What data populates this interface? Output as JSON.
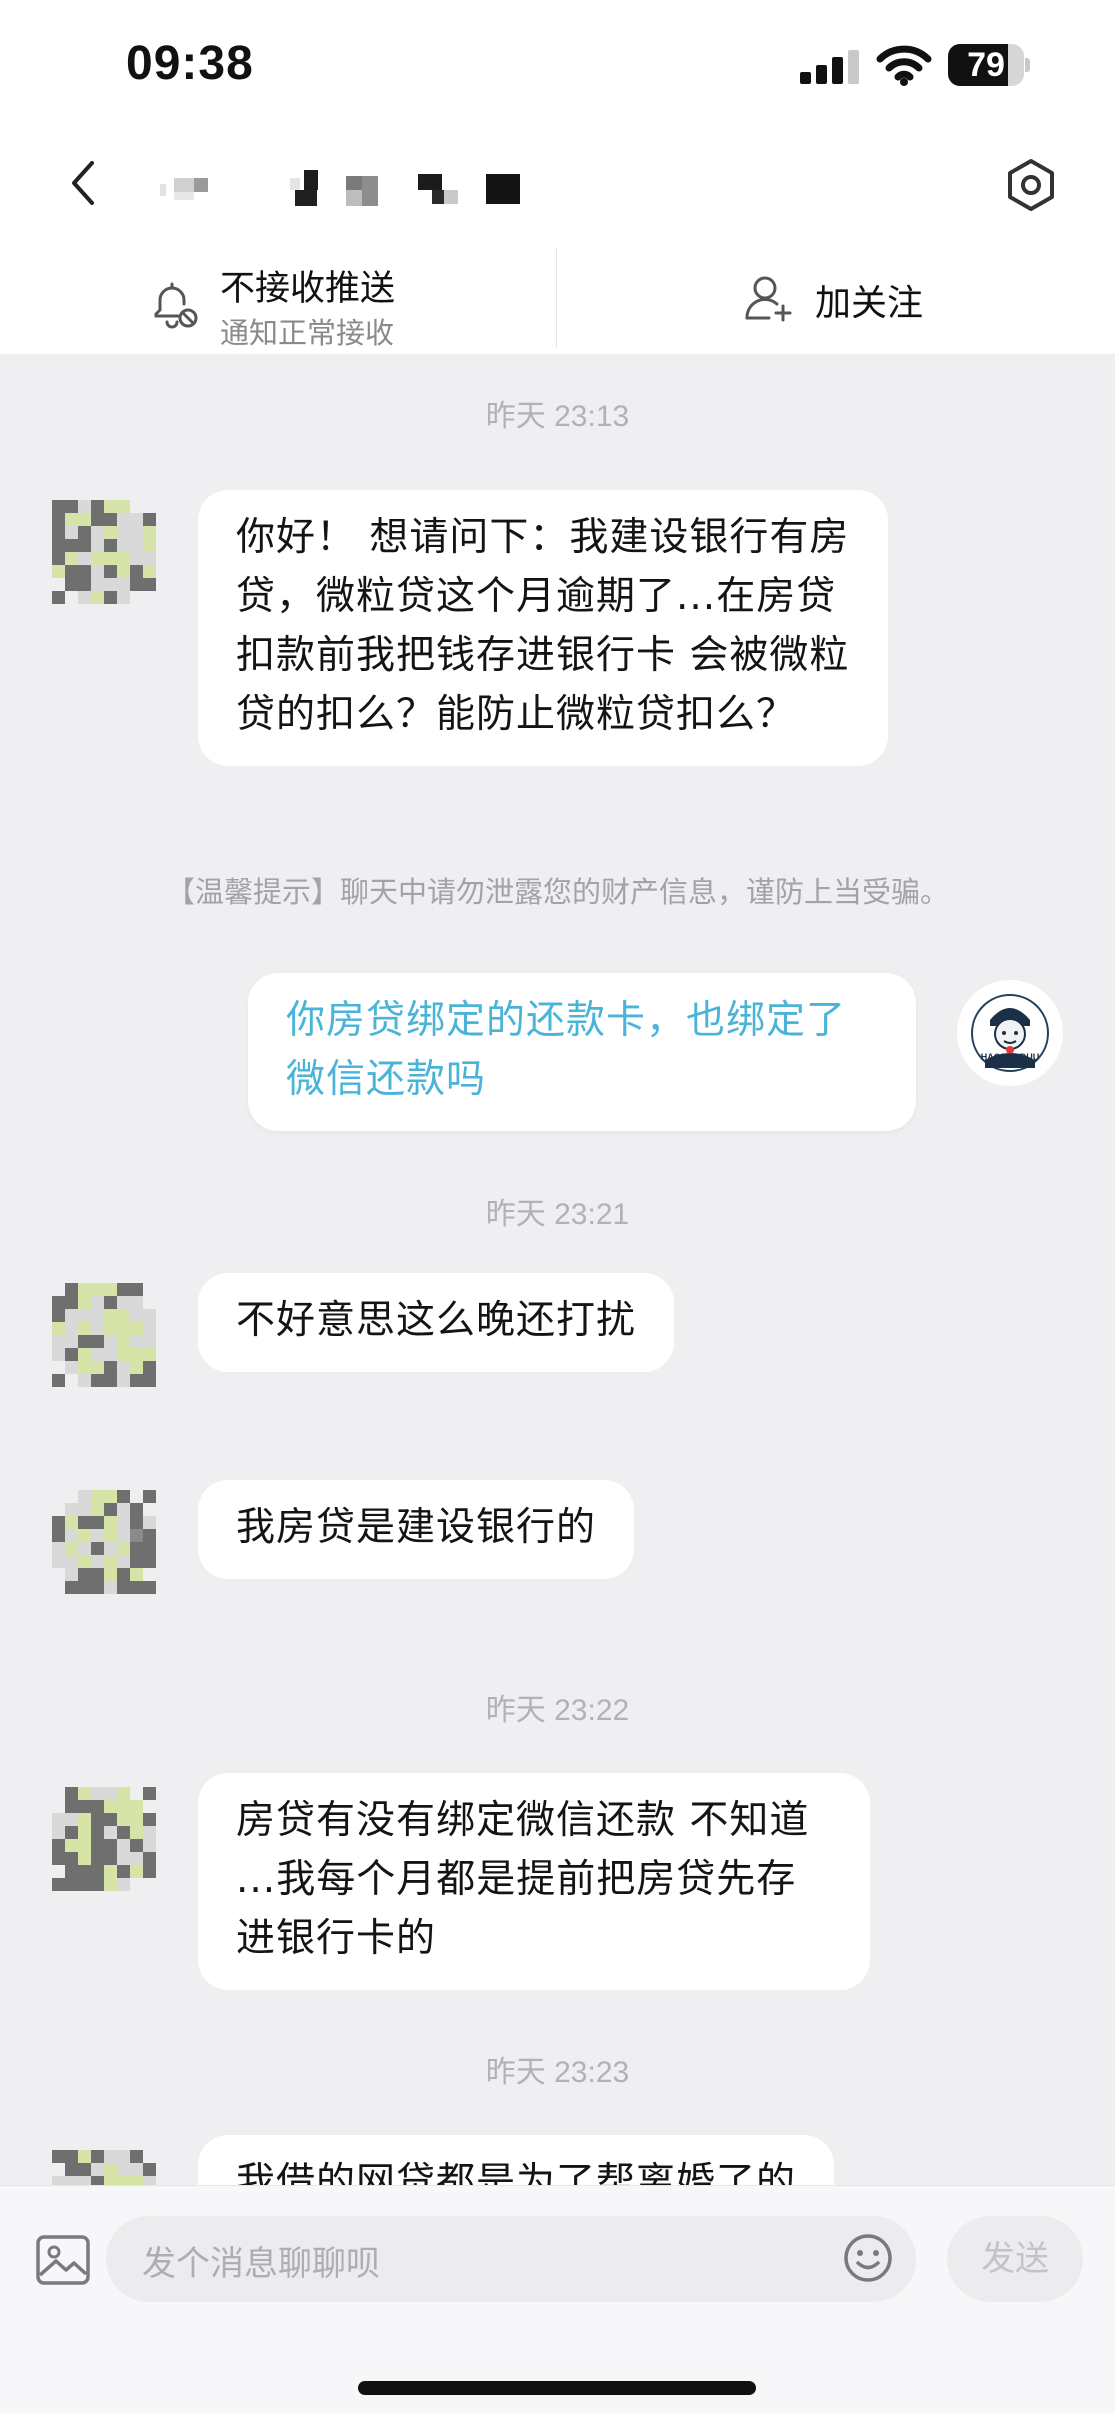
{
  "status_bar": {
    "time": "09:38",
    "battery_level": "79",
    "battery_fraction": 0.79
  },
  "header": {
    "back_icon": "chevron-left-icon",
    "settings_icon": "hexagon-gear-icon"
  },
  "subscribe_bar": {
    "push_title": "不接收推送",
    "push_subtitle": "通知正常接收",
    "follow_label": "加关注"
  },
  "chat": {
    "timestamps": [
      "昨天 23:13",
      "昨天 23:21",
      "昨天 23:22",
      "昨天 23:23"
    ],
    "tip": "【温馨提示】聊天中请勿泄露您的财产信息，谨防上当受骗。",
    "messages": [
      {
        "sender": "other",
        "text": "你好！ 想请问下：我建设银行有房贷，微粒贷这个月逾期了...在房贷扣款前我把钱存进银行卡  会被微粒贷的扣么？能防止微粒贷扣么？"
      },
      {
        "sender": "me",
        "text": "你房贷绑定的还款卡，也绑定了微信还款吗"
      },
      {
        "sender": "other",
        "text": "不好意思这么晚还打扰"
      },
      {
        "sender": "other",
        "text": "我房贷是建设银行的"
      },
      {
        "sender": "other",
        "text": "房贷有没有绑定微信还款 不知道 ...我每个月都是提前把房贷先存进银行卡的"
      },
      {
        "sender": "other",
        "text": "我借的网贷都是为了帮离婚了的"
      }
    ],
    "my_avatar_text": "HAORENDUU"
  },
  "input_bar": {
    "placeholder": "发个消息聊聊呗",
    "send_label": "发送",
    "image_icon": "image-icon",
    "emoji_icon": "smiley-icon"
  },
  "colors": {
    "chat_background": "#efeff1",
    "my_message_text": "#4ab4d8",
    "timestamp_text": "#b2b2b6"
  }
}
